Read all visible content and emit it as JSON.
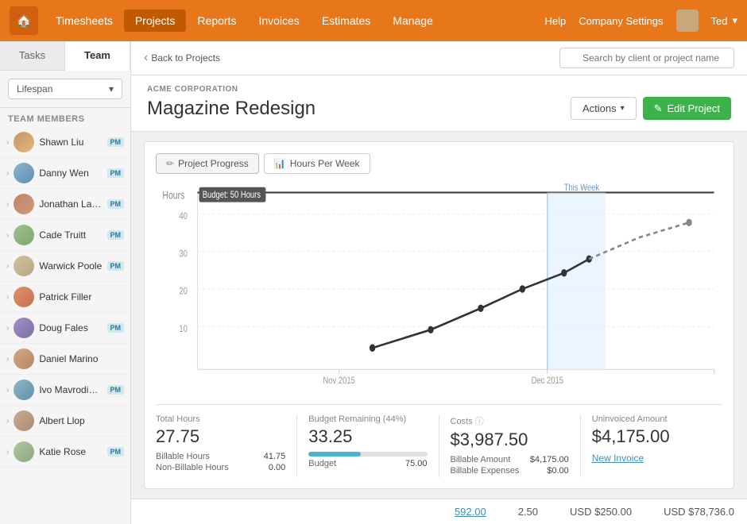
{
  "nav": {
    "home_icon": "🏠",
    "items": [
      {
        "label": "Timesheets",
        "active": false
      },
      {
        "label": "Projects",
        "active": true
      },
      {
        "label": "Reports",
        "active": false
      },
      {
        "label": "Invoices",
        "active": false
      },
      {
        "label": "Estimates",
        "active": false
      },
      {
        "label": "Manage",
        "active": false
      }
    ],
    "right": {
      "help": "Help",
      "company_settings": "Company Settings",
      "user": "Ted"
    },
    "search_placeholder": "Search by client or project name"
  },
  "breadcrumb": {
    "back_label": "Back to Projects"
  },
  "project": {
    "company": "ACME CORPORATION",
    "title": "Magazine Redesign",
    "actions_label": "Actions",
    "edit_label": "Edit Project"
  },
  "sidebar": {
    "tabs": [
      {
        "label": "Tasks",
        "active": false
      },
      {
        "label": "Team",
        "active": true
      }
    ],
    "filter": "Lifespan",
    "members_header": "Team Members",
    "members": [
      {
        "name": "Shawn Liu",
        "pm": true,
        "av": "av-1"
      },
      {
        "name": "Danny Wen",
        "pm": true,
        "av": "av-2"
      },
      {
        "name": "Jonathan Lane",
        "pm": true,
        "av": "av-3"
      },
      {
        "name": "Cade Truitt",
        "pm": true,
        "av": "av-4"
      },
      {
        "name": "Warwick Poole",
        "pm": true,
        "av": "av-5"
      },
      {
        "name": "Patrick Filler",
        "pm": false,
        "av": "av-6"
      },
      {
        "name": "Doug Fales",
        "pm": true,
        "av": "av-7"
      },
      {
        "name": "Daniel Marino",
        "pm": false,
        "av": "av-8"
      },
      {
        "name": "Ivo Mavrodinov",
        "pm": true,
        "av": "av-9"
      },
      {
        "name": "Albert Llop",
        "pm": false,
        "av": "av-10"
      },
      {
        "name": "Katie Rose",
        "pm": true,
        "av": "av-11"
      }
    ]
  },
  "chart": {
    "tabs": [
      {
        "label": "Project Progress",
        "icon": "✏",
        "active": true
      },
      {
        "label": "Hours Per Week",
        "icon": "📊",
        "active": false
      }
    ],
    "y_label": "Hours",
    "budget_label": "Budget: 50 Hours",
    "this_week_label": "This Week",
    "x_labels": [
      "Nov 2015",
      "Dec 2015"
    ]
  },
  "stats": [
    {
      "label": "Total Hours",
      "value": "27.75",
      "details": [
        {
          "label": "Billable Hours",
          "value": "41.75"
        },
        {
          "label": "Non-Billable Hours",
          "value": "0.00"
        }
      ]
    },
    {
      "label": "Budget Remaining (44%)",
      "value": "33.25",
      "progress": 44,
      "details": [
        {
          "label": "Budget",
          "value": "75.00"
        }
      ]
    },
    {
      "label": "Costs",
      "value": "$3,987.50",
      "info": true,
      "details": [
        {
          "label": "Billable Amount",
          "value": "$4,175.00"
        },
        {
          "label": "Billable Expenses",
          "value": "$0.00"
        }
      ]
    },
    {
      "label": "Uninvoiced Amount",
      "value": "$4,175.00",
      "invoice_link": "New Invoice"
    }
  ],
  "bottom": {
    "link_value": "592.00",
    "hours": "2.50",
    "usd1": "USD $250.00",
    "usd2": "USD $78,736.0"
  }
}
